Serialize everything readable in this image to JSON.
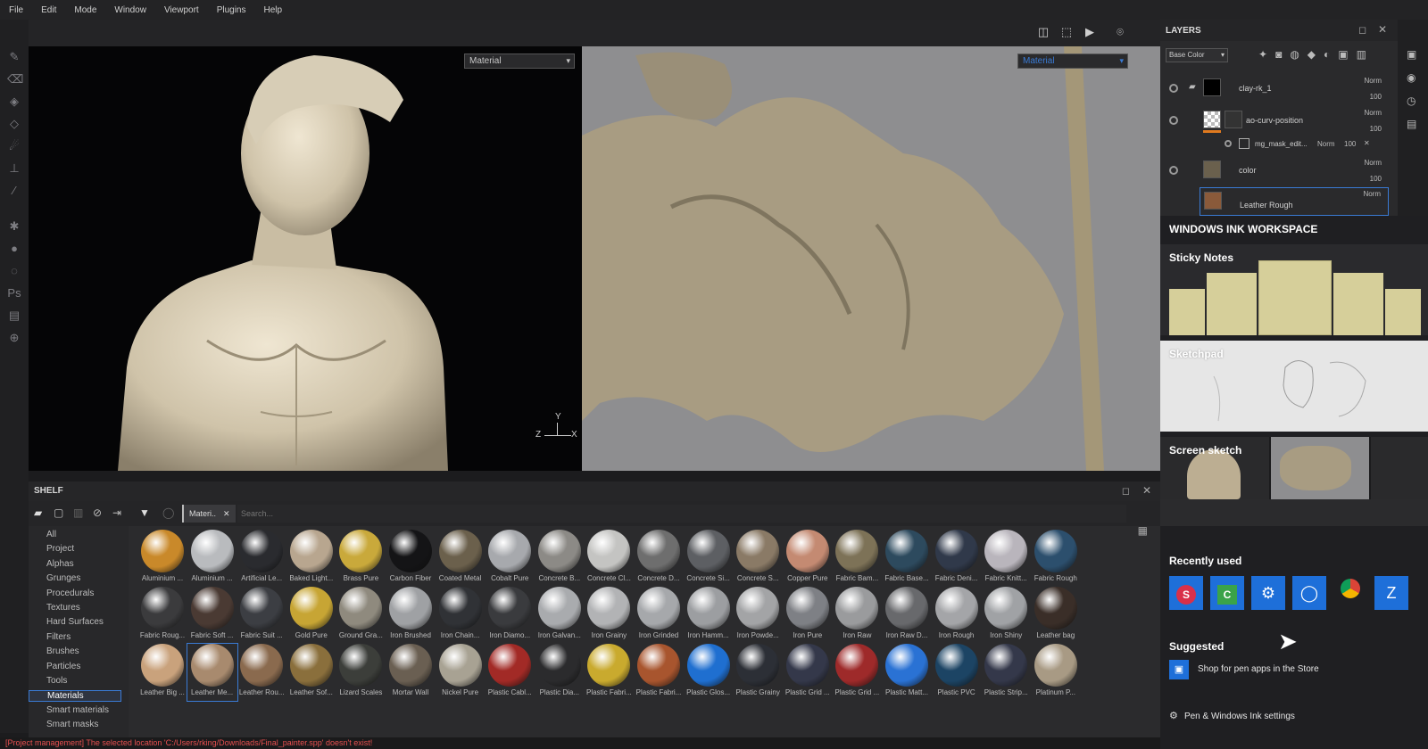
{
  "menu": [
    "File",
    "Edit",
    "Mode",
    "Window",
    "Viewport",
    "Plugins",
    "Help"
  ],
  "viewport_left": {
    "select_value": "Material",
    "axes": {
      "y": "Y",
      "z": "Z",
      "x": "X"
    }
  },
  "viewport_right": {
    "select_value": "Material"
  },
  "shelf": {
    "title": "SHELF",
    "filter_tag": "Materi..",
    "search_placeholder": "Search...",
    "categories": [
      "All",
      "Project",
      "Alphas",
      "Grunges",
      "Procedurals",
      "Textures",
      "Hard Surfaces",
      "Filters",
      "Brushes",
      "Particles",
      "Tools",
      "Materials",
      "Smart materials",
      "Smart masks"
    ],
    "selected_category": "Materials",
    "materials_row1": [
      {
        "label": "Aluminium ...",
        "color": "#c9892a"
      },
      {
        "label": "Aluminium ...",
        "color": "#b9bbbe"
      },
      {
        "label": "Artificial Le...",
        "color": "#2a2b2f"
      },
      {
        "label": "Baked Light...",
        "color": "#b8a68f"
      },
      {
        "label": "Brass Pure",
        "color": "#c9a93b"
      },
      {
        "label": "Carbon Fiber",
        "color": "#141416"
      },
      {
        "label": "Coated Metal",
        "color": "#6b604c"
      },
      {
        "label": "Cobalt Pure",
        "color": "#a7a9ad"
      },
      {
        "label": "Concrete B...",
        "color": "#8c8a86"
      },
      {
        "label": "Concrete Cl...",
        "color": "#c4c4c2"
      },
      {
        "label": "Concrete D...",
        "color": "#6e6e6e"
      },
      {
        "label": "Concrete Si...",
        "color": "#5d5f63"
      },
      {
        "label": "Concrete S...",
        "color": "#8a7a66"
      },
      {
        "label": "Copper Pure",
        "color": "#c48a72"
      },
      {
        "label": "Fabric Bam...",
        "color": "#7d7257"
      },
      {
        "label": "Fabric Base...",
        "color": "#2d4a5e"
      },
      {
        "label": "Fabric Deni...",
        "color": "#30394a"
      },
      {
        "label": "Fabric Knitt...",
        "color": "#b9b5bc"
      },
      {
        "label": "Fabric Rough",
        "color": "#2c4f6d"
      }
    ],
    "materials_row2": [
      {
        "label": "Fabric Roug...",
        "color": "#3b3b3d"
      },
      {
        "label": "Fabric Soft ...",
        "color": "#4a3a33"
      },
      {
        "label": "Fabric Suit ...",
        "color": "#3c3e43"
      },
      {
        "label": "Gold Pure",
        "color": "#c7a534"
      },
      {
        "label": "Ground Gra...",
        "color": "#8f8a7e"
      },
      {
        "label": "Iron Brushed",
        "color": "#9fa1a4"
      },
      {
        "label": "Iron Chain...",
        "color": "#303236"
      },
      {
        "label": "Iron Diamo...",
        "color": "#3a3b3e"
      },
      {
        "label": "Iron Galvan...",
        "color": "#a9abae"
      },
      {
        "label": "Iron Grainy",
        "color": "#b2b3b5"
      },
      {
        "label": "Iron Grinded",
        "color": "#a6a8ab"
      },
      {
        "label": "Iron Hamm...",
        "color": "#9c9ea1"
      },
      {
        "label": "Iron Powde...",
        "color": "#a3a4a6"
      },
      {
        "label": "Iron Pure",
        "color": "#7e8085"
      },
      {
        "label": "Iron Raw",
        "color": "#9a9b9d"
      },
      {
        "label": "Iron Raw D...",
        "color": "#68696c"
      },
      {
        "label": "Iron Rough",
        "color": "#a4a5a8"
      },
      {
        "label": "Iron Shiny",
        "color": "#a0a2a5"
      },
      {
        "label": "Leather bag",
        "color": "#3a2e28"
      }
    ],
    "materials_row3": [
      {
        "label": "Leather Big ...",
        "color": "#c9a27c"
      },
      {
        "label": "Leather Me...",
        "color": "#a88a6e"
      },
      {
        "label": "Leather Rou...",
        "color": "#8a6a4e"
      },
      {
        "label": "Leather Sof...",
        "color": "#8a6f3c"
      },
      {
        "label": "Lizard Scales",
        "color": "#3c3e3a"
      },
      {
        "label": "Mortar Wall",
        "color": "#6a5f52"
      },
      {
        "label": "Nickel Pure",
        "color": "#a8a293"
      },
      {
        "label": "Plastic Cabl...",
        "color": "#a22a26"
      },
      {
        "label": "Plastic Dia...",
        "color": "#2b2b2d"
      },
      {
        "label": "Plastic Fabri...",
        "color": "#c9aa2e"
      },
      {
        "label": "Plastic Fabri...",
        "color": "#a8552e"
      },
      {
        "label": "Plastic Glos...",
        "color": "#1f6fd0"
      },
      {
        "label": "Plastic Grainy",
        "color": "#2c2f36"
      },
      {
        "label": "Plastic Grid ...",
        "color": "#34384a"
      },
      {
        "label": "Plastic Grid ...",
        "color": "#9e2a2a"
      },
      {
        "label": "Plastic Matt...",
        "color": "#2a72d4"
      },
      {
        "label": "Plastic PVC",
        "color": "#1c4464"
      },
      {
        "label": "Plastic Strip...",
        "color": "#34384a"
      },
      {
        "label": "Platinum P...",
        "color": "#a89a84"
      }
    ]
  },
  "status_message": "[Project management] The selected location 'C:/Users/rking/Downloads/Final_painter.spp' doesn't exist!",
  "layers": {
    "title": "LAYERS",
    "channel": "Base Color",
    "items": [
      {
        "name": "clay-rk_1",
        "blend": "Norm",
        "opacity": "100"
      },
      {
        "name": "ao-curv-position",
        "blend": "Norm",
        "opacity": "100"
      },
      {
        "name": "mg_mask_edit...",
        "blend": "Norm",
        "opacity": "100"
      },
      {
        "name": "color",
        "blend": "Norm",
        "opacity": "100"
      },
      {
        "name": "Leather Rough",
        "blend": "Norm",
        "opacity": ""
      }
    ]
  },
  "ink": {
    "title": "WINDOWS INK WORKSPACE",
    "sticky_notes": "Sticky Notes",
    "sketchpad": "Sketchpad",
    "screen_sketch": "Screen sketch",
    "recently_used": "Recently used",
    "recent_apps": [
      {
        "icon": "substance-icon",
        "glyph": "S",
        "color": "#1e6fd9"
      },
      {
        "icon": "camtasia-icon",
        "glyph": "C",
        "color": "#1e6fd9"
      },
      {
        "icon": "settings-icon",
        "glyph": "⚙",
        "color": "#1e6fd9"
      },
      {
        "icon": "cortana-icon",
        "glyph": "◯",
        "color": "#1e6fd9"
      },
      {
        "icon": "chrome-icon",
        "glyph": "◉",
        "color": "#1f1f22"
      },
      {
        "icon": "zbrush-icon",
        "glyph": "Z",
        "color": "#1e6fd9"
      }
    ],
    "suggested": "Suggested",
    "store_link": "Shop for pen apps in the Store",
    "settings_link": "Pen & Windows Ink settings"
  },
  "colors": {
    "accent": "#1e6fd9",
    "sticky": "#d6cf9a",
    "error": "#e85050"
  }
}
